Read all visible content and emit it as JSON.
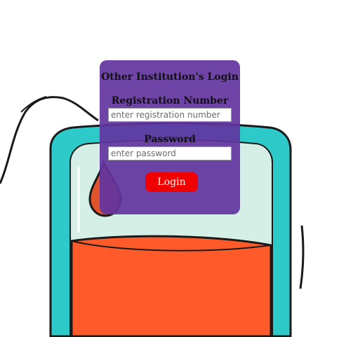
{
  "login_form": {
    "title": "Other Institution's Login",
    "registration_label": "Registration Number",
    "registration_placeholder": "enter registration number",
    "registration_value": "",
    "password_label": "Password",
    "password_placeholder": "enter password",
    "password_value": "",
    "login_button_label": "Login"
  },
  "background": {
    "icon": "blood-bag-icon"
  },
  "colors": {
    "card": "#6234a0",
    "button": "#f00000",
    "bag_outline": "#2ec9c9",
    "bag_inner": "#d6efe6",
    "blood": "#ff5a2a",
    "drop": "#e0532b"
  }
}
